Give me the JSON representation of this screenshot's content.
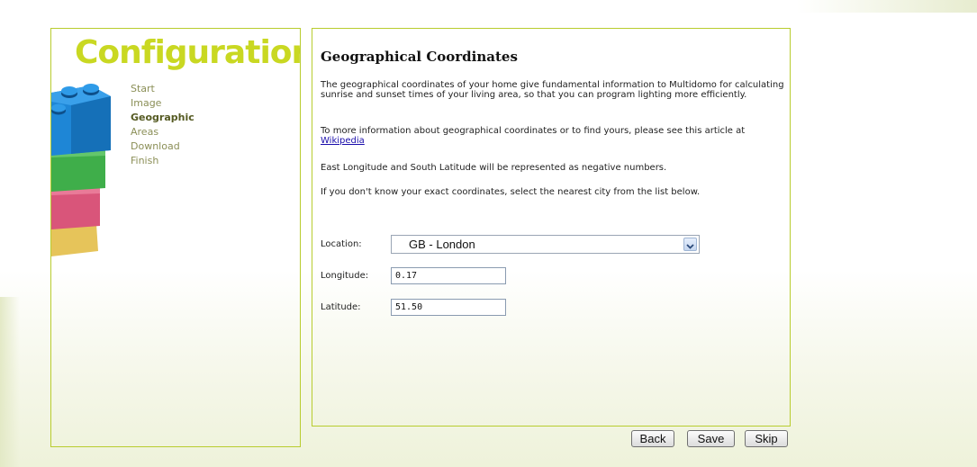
{
  "sidebar": {
    "title": "Configuration",
    "steps": [
      "Start",
      "Image",
      "Geographic",
      "Areas",
      "Download",
      "Finish"
    ],
    "active_step": "Geographic"
  },
  "main": {
    "title": "Geographical Coordinates",
    "para1": "The geographical coordinates of your home give fundamental information to Multidomo for calculating sunrise and sunset times of your living area, so that you can program lighting more efficiently.",
    "para2_text": "To more information about geographical coordinates or to find yours, please see this article at ",
    "para2_link": "Wikipedia",
    "para3": "East Longitude and South Latitude will be represented as negative numbers.",
    "para4": "If you don't know your exact coordinates, select the nearest city from the list below.",
    "location_label": "Location:",
    "location_value": "GB - London",
    "longitude_label": "Longitude:",
    "longitude_value": "0.17",
    "latitude_label": "Latitude:",
    "latitude_value": "51.50"
  },
  "buttons": {
    "back": "Back",
    "save": "Save",
    "skip": "Skip"
  },
  "colors": {
    "accent": "#c9d822",
    "border": "#b8cc2e",
    "link": "#1a0dab"
  }
}
